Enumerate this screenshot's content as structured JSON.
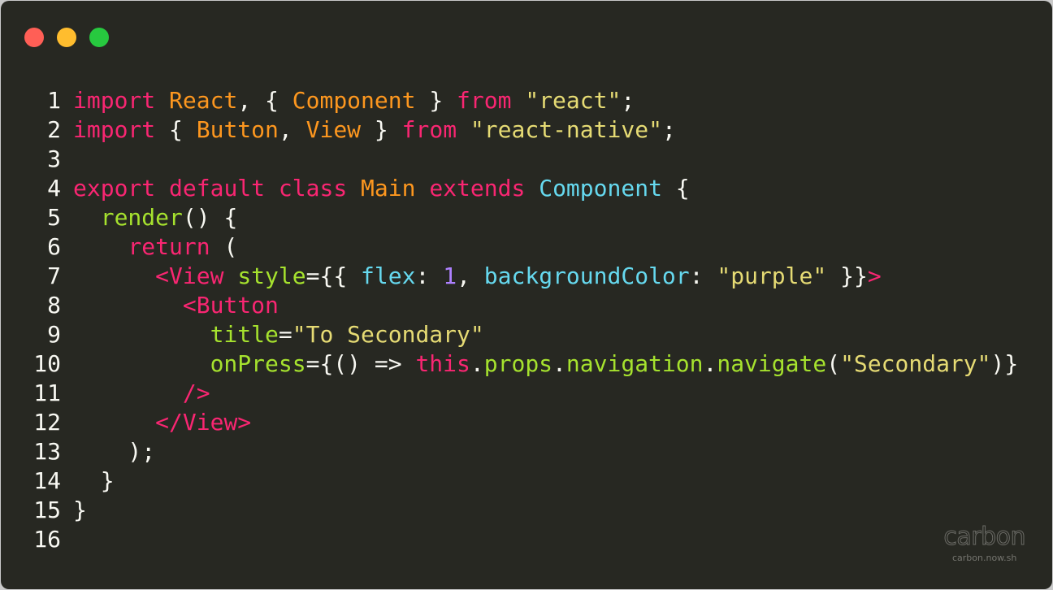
{
  "window": {
    "controls": [
      {
        "name": "close",
        "color": "#ff5f56"
      },
      {
        "name": "minimize",
        "color": "#ffbd2e"
      },
      {
        "name": "maximize",
        "color": "#27c93f"
      }
    ]
  },
  "colors": {
    "background": "#272822",
    "text": "#f8f8f2",
    "keyword": "#f92672",
    "class": "#fd971f",
    "string": "#e6db74",
    "function": "#a6e22e",
    "type": "#66d9ef",
    "number": "#ae81ff"
  },
  "code": {
    "lines": [
      {
        "number": "1",
        "tokens": [
          {
            "t": "import",
            "c": "keyword"
          },
          {
            "t": " ",
            "c": "text"
          },
          {
            "t": "React",
            "c": "class"
          },
          {
            "t": ", { ",
            "c": "text"
          },
          {
            "t": "Component",
            "c": "class"
          },
          {
            "t": " } ",
            "c": "text"
          },
          {
            "t": "from",
            "c": "keyword"
          },
          {
            "t": " ",
            "c": "text"
          },
          {
            "t": "\"react\"",
            "c": "string"
          },
          {
            "t": ";",
            "c": "text"
          }
        ]
      },
      {
        "number": "2",
        "tokens": [
          {
            "t": "import",
            "c": "keyword"
          },
          {
            "t": " { ",
            "c": "text"
          },
          {
            "t": "Button",
            "c": "class"
          },
          {
            "t": ", ",
            "c": "text"
          },
          {
            "t": "View",
            "c": "class"
          },
          {
            "t": " } ",
            "c": "text"
          },
          {
            "t": "from",
            "c": "keyword"
          },
          {
            "t": " ",
            "c": "text"
          },
          {
            "t": "\"react-native\"",
            "c": "string"
          },
          {
            "t": ";",
            "c": "text"
          }
        ]
      },
      {
        "number": "3",
        "tokens": []
      },
      {
        "number": "4",
        "tokens": [
          {
            "t": "export",
            "c": "keyword"
          },
          {
            "t": " ",
            "c": "text"
          },
          {
            "t": "default",
            "c": "keyword"
          },
          {
            "t": " ",
            "c": "text"
          },
          {
            "t": "class",
            "c": "keyword"
          },
          {
            "t": " ",
            "c": "text"
          },
          {
            "t": "Main",
            "c": "class"
          },
          {
            "t": " ",
            "c": "text"
          },
          {
            "t": "extends",
            "c": "keyword"
          },
          {
            "t": " ",
            "c": "text"
          },
          {
            "t": "Component",
            "c": "type"
          },
          {
            "t": " {",
            "c": "text"
          }
        ]
      },
      {
        "number": "5",
        "tokens": [
          {
            "t": "  ",
            "c": "text"
          },
          {
            "t": "render",
            "c": "function"
          },
          {
            "t": "() {",
            "c": "text"
          }
        ]
      },
      {
        "number": "6",
        "tokens": [
          {
            "t": "    ",
            "c": "text"
          },
          {
            "t": "return",
            "c": "keyword"
          },
          {
            "t": " (",
            "c": "text"
          }
        ]
      },
      {
        "number": "7",
        "tokens": [
          {
            "t": "      ",
            "c": "text"
          },
          {
            "t": "<View",
            "c": "keyword"
          },
          {
            "t": " ",
            "c": "text"
          },
          {
            "t": "style",
            "c": "function"
          },
          {
            "t": "={{ ",
            "c": "text"
          },
          {
            "t": "flex",
            "c": "type"
          },
          {
            "t": ": ",
            "c": "text"
          },
          {
            "t": "1",
            "c": "number"
          },
          {
            "t": ", ",
            "c": "text"
          },
          {
            "t": "backgroundColor",
            "c": "type"
          },
          {
            "t": ": ",
            "c": "text"
          },
          {
            "t": "\"purple\"",
            "c": "string"
          },
          {
            "t": " }}",
            "c": "text"
          },
          {
            "t": ">",
            "c": "keyword"
          }
        ]
      },
      {
        "number": "8",
        "tokens": [
          {
            "t": "        ",
            "c": "text"
          },
          {
            "t": "<Button",
            "c": "keyword"
          }
        ]
      },
      {
        "number": "9",
        "tokens": [
          {
            "t": "          ",
            "c": "text"
          },
          {
            "t": "title",
            "c": "function"
          },
          {
            "t": "=",
            "c": "text"
          },
          {
            "t": "\"To Secondary\"",
            "c": "string"
          }
        ]
      },
      {
        "number": "10",
        "tokens": [
          {
            "t": "          ",
            "c": "text"
          },
          {
            "t": "onPress",
            "c": "function"
          },
          {
            "t": "={() => ",
            "c": "text"
          },
          {
            "t": "this",
            "c": "keyword"
          },
          {
            "t": ".",
            "c": "text"
          },
          {
            "t": "props",
            "c": "function"
          },
          {
            "t": ".",
            "c": "text"
          },
          {
            "t": "navigation",
            "c": "function"
          },
          {
            "t": ".",
            "c": "text"
          },
          {
            "t": "navigate",
            "c": "function"
          },
          {
            "t": "(",
            "c": "text"
          },
          {
            "t": "\"Secondary\"",
            "c": "string"
          },
          {
            "t": ")}",
            "c": "text"
          }
        ]
      },
      {
        "number": "11",
        "tokens": [
          {
            "t": "        ",
            "c": "text"
          },
          {
            "t": "/>",
            "c": "keyword"
          }
        ]
      },
      {
        "number": "12",
        "tokens": [
          {
            "t": "      ",
            "c": "text"
          },
          {
            "t": "</View>",
            "c": "keyword"
          }
        ]
      },
      {
        "number": "13",
        "tokens": [
          {
            "t": "    );",
            "c": "text"
          }
        ]
      },
      {
        "number": "14",
        "tokens": [
          {
            "t": "  }",
            "c": "text"
          }
        ]
      },
      {
        "number": "15",
        "tokens": [
          {
            "t": "}",
            "c": "text"
          }
        ]
      },
      {
        "number": "16",
        "tokens": []
      }
    ]
  },
  "watermark": {
    "logo": "carbon",
    "url": "carbon.now.sh"
  }
}
